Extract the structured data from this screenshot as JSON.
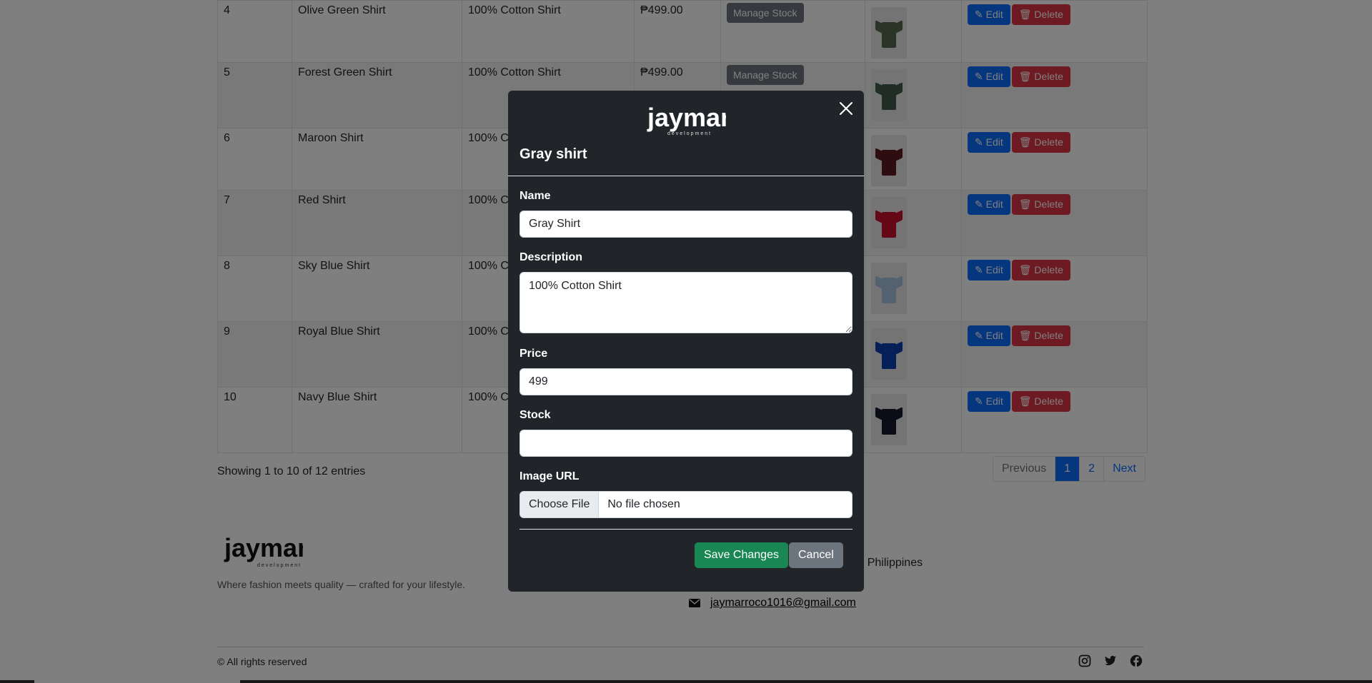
{
  "table": {
    "manage_label": "Manage Stock",
    "edit_label": "Edit",
    "delete_label": "Delete",
    "rows": [
      {
        "id": "4",
        "name": "Olive Green Shirt",
        "description": "100% Cotton Shirt",
        "price": "₱499.00",
        "color": "#556b4f"
      },
      {
        "id": "5",
        "name": "Forest Green Shirt",
        "description": "100% Cotton Shirt",
        "price": "₱499.00",
        "color": "#3e5a48"
      },
      {
        "id": "6",
        "name": "Maroon Shirt",
        "description": "100% Co",
        "price": "",
        "color": "#5c1a22"
      },
      {
        "id": "7",
        "name": "Red Shirt",
        "description": "100% Co",
        "price": "",
        "color": "#c8102e"
      },
      {
        "id": "8",
        "name": "Sky Blue Shirt",
        "description": "100% Co",
        "price": "",
        "color": "#a9c4de"
      },
      {
        "id": "9",
        "name": "Royal Blue Shirt",
        "description": "100% Co",
        "price": "",
        "color": "#0b3fb0"
      },
      {
        "id": "10",
        "name": "Navy Blue Shirt",
        "description": "100% Co",
        "price": "",
        "color": "#141a2e"
      }
    ]
  },
  "entries_text": "Showing 1 to 10 of 12 entries",
  "pagination": {
    "previous": "Previous",
    "pages": [
      "1",
      "2"
    ],
    "next": "Next",
    "active": "1"
  },
  "footer": {
    "brand": "jaymar",
    "brand_sub": "development",
    "tagline": "Where fashion meets quality — crafted for your lifestyle.",
    "address_fragment": "ity, Philippines",
    "email": "jaymarroco1016@gmail.com",
    "rights": "© All rights reserved",
    "socials": [
      "instagram-icon",
      "twitter-icon",
      "facebook-icon"
    ]
  },
  "modal": {
    "brand": "jaymar",
    "brand_sub": "development",
    "title": "Gray shirt",
    "name_label": "Name",
    "name_value": "Gray Shirt",
    "description_label": "Description",
    "description_value": "100% Cotton Shirt",
    "price_label": "Price",
    "price_value": "499",
    "stock_label": "Stock",
    "stock_value": "",
    "image_label": "Image URL",
    "file_button": "Choose File",
    "file_status": "No file chosen",
    "save_label": "Save Changes",
    "cancel_label": "Cancel"
  },
  "colors": {
    "modal_bg": "#212529",
    "primary": "#0d6efd",
    "danger": "#dc3545",
    "success": "#198754",
    "secondary": "#6c757d"
  }
}
